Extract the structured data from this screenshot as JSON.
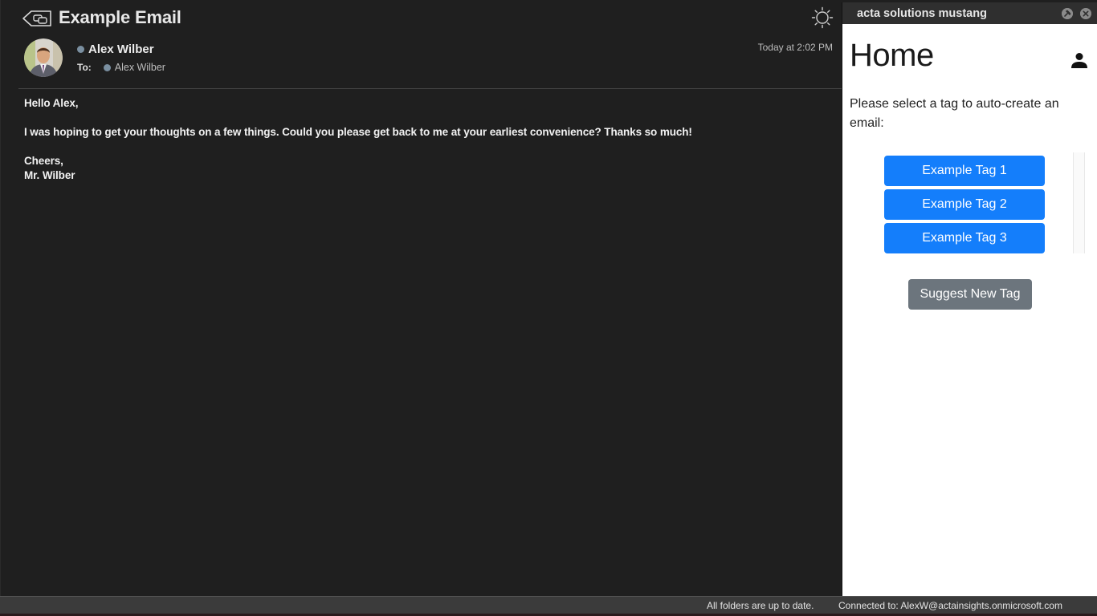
{
  "email": {
    "subject": "Example Email",
    "sender_name": "Alex Wilber",
    "to_label": "To:",
    "to_name": "Alex Wilber",
    "timestamp": "Today at 2:02 PM",
    "body": {
      "greeting": "Hello Alex,",
      "paragraph": "I was hoping to get your thoughts on a few things. Could you please get back to me at your earliest convenience? Thanks so much!",
      "signoff": "Cheers,",
      "signature": "Mr. Wilber"
    },
    "icons": {
      "back": "back-reply-icon",
      "theme": "sun-icon",
      "presence": "presence-dot"
    },
    "presence_color": "#7a8fa0"
  },
  "addin": {
    "title": "acta solutions mustang",
    "heading": "Home",
    "instructions": "Please select a tag to auto-create an email:",
    "tags": [
      {
        "label": "Example Tag 1"
      },
      {
        "label": "Example Tag 2"
      },
      {
        "label": "Example Tag 3"
      }
    ],
    "suggest_label": "Suggest New Tag",
    "icons": {
      "pin": "pin-icon",
      "close": "close-icon",
      "user": "user-icon"
    },
    "colors": {
      "tag_button": "#147efb",
      "suggest_button": "#6c757d"
    }
  },
  "statusbar": {
    "sync_status": "All folders are up to date.",
    "connection": "Connected to: AlexW@actainsights.onmicrosoft.com"
  }
}
